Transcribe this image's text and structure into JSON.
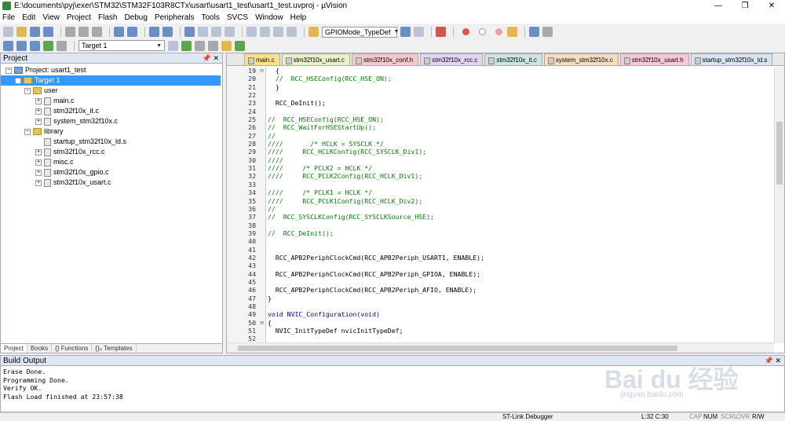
{
  "window": {
    "title": "E:\\documents\\pyj\\exer\\STM32\\STM32F103R8CTx\\usart\\usart1_test\\usart1_test.uvproj - µVision",
    "minimize": "—",
    "maximize": "❐",
    "close": "✕"
  },
  "menu": [
    "File",
    "Edit",
    "View",
    "Project",
    "Flash",
    "Debug",
    "Peripherals",
    "Tools",
    "SVCS",
    "Window",
    "Help"
  ],
  "toolbar": {
    "find_select": "GPIOMode_TypeDef",
    "target_select": "Target 1"
  },
  "project_panel": {
    "title": "Project",
    "pin": "📌 ✕",
    "root": "Project: usart1_test",
    "target": "Target 1",
    "groups": [
      {
        "name": "user",
        "files": [
          "main.c",
          "stm32f10x_it.c",
          "system_stm32f10x.c"
        ]
      },
      {
        "name": "library",
        "files": [
          "startup_stm32f10x_ld.s",
          "stm32f10x_rcc.c",
          "misc.c",
          "stm32f10x_gpio.c",
          "stm32f10x_usart.c"
        ]
      }
    ],
    "tabs": [
      "Project",
      "Books",
      "{} Functions",
      "{}₀ Templates"
    ]
  },
  "editor": {
    "tabs": [
      "main.c",
      "stm32f10x_usart.c",
      "stm32f10x_conf.h",
      "stm32f10x_rcc.c",
      "stm32f10x_it.c",
      "system_stm32f10x.c",
      "stm32f10x_usart.h",
      "startup_stm32f10x_ld.s"
    ],
    "lines": [
      {
        "n": "19",
        "f": "⊟",
        "t": "  {"
      },
      {
        "n": "20",
        "f": "",
        "t": "  //  RCC_HSEConfig(RCC_HSE_ON);"
      },
      {
        "n": "21",
        "f": "",
        "t": "  }"
      },
      {
        "n": "22",
        "f": "",
        "t": ""
      },
      {
        "n": "23",
        "f": "",
        "t": "  RCC_DeInit();"
      },
      {
        "n": "24",
        "f": "",
        "t": ""
      },
      {
        "n": "25",
        "f": "",
        "t": "//  RCC_HSEConfig(RCC_HSE_ON);"
      },
      {
        "n": "26",
        "f": "",
        "t": "//  RCC_WaitForHSEStartUp();"
      },
      {
        "n": "27",
        "f": "",
        "t": "//"
      },
      {
        "n": "28",
        "f": "",
        "t": "////       /* HCLK = SYSCLK */"
      },
      {
        "n": "29",
        "f": "",
        "t": "////     RCC_HCLKConfig(RCC_SYSCLK_Div1);"
      },
      {
        "n": "30",
        "f": "",
        "t": "////"
      },
      {
        "n": "31",
        "f": "",
        "t": "////     /* PCLK2 = HCLK */"
      },
      {
        "n": "32",
        "f": "",
        "t": "////     RCC_PCLK2Config(RCC_HCLK_Div1);"
      },
      {
        "n": "33",
        "f": "",
        "t": ""
      },
      {
        "n": "34",
        "f": "",
        "t": "////     /* PCLK1 = HCLK */"
      },
      {
        "n": "35",
        "f": "",
        "t": "////     RCC_PCLK1Config(RCC_HCLK_Div2);"
      },
      {
        "n": "36",
        "f": "",
        "t": "//"
      },
      {
        "n": "37",
        "f": "",
        "t": "//  RCC_SYSCLKConfig(RCC_SYSCLKSource_HSE);"
      },
      {
        "n": "38",
        "f": "",
        "t": ""
      },
      {
        "n": "39",
        "f": "",
        "t": "//  RCC_DeInit();"
      },
      {
        "n": "40",
        "f": "",
        "t": ""
      },
      {
        "n": "41",
        "f": "",
        "t": ""
      },
      {
        "n": "42",
        "f": "",
        "t": "  RCC_APB2PeriphClockCmd(RCC_APB2Periph_USART1, ENABLE);"
      },
      {
        "n": "43",
        "f": "",
        "t": ""
      },
      {
        "n": "44",
        "f": "",
        "t": "  RCC_APB2PeriphClockCmd(RCC_APB2Periph_GPIOA, ENABLE);"
      },
      {
        "n": "45",
        "f": "",
        "t": ""
      },
      {
        "n": "46",
        "f": "",
        "t": "  RCC_APB2PeriphClockCmd(RCC_APB2Periph_AFIO, ENABLE);"
      },
      {
        "n": "47",
        "f": "",
        "t": "}"
      },
      {
        "n": "48",
        "f": "",
        "t": ""
      },
      {
        "n": "49",
        "f": "",
        "t": "void NVIC_Configuration(void)"
      },
      {
        "n": "50",
        "f": "⊟",
        "t": "{"
      },
      {
        "n": "51",
        "f": "",
        "t": "  NVIC_InitTypeDef nvicInitTypeDef;"
      },
      {
        "n": "52",
        "f": "",
        "t": ""
      }
    ]
  },
  "build_output": {
    "title": "Build Output",
    "pin": "📌 ✕",
    "lines": [
      "Erase Done.",
      "Programming Done.",
      "Verify OK.",
      "Flash Load finished at 23:57:38"
    ]
  },
  "status": {
    "debugger": "ST-Link Debugger",
    "position": "L:32 C:30",
    "caps": "CAP",
    "num": "NUM",
    "scrl": "SCRL",
    "ovr": "OVR",
    "rw": "R/W"
  },
  "watermark": {
    "main": "Bai du 经验",
    "sub": "jingyan.baidu.com"
  }
}
